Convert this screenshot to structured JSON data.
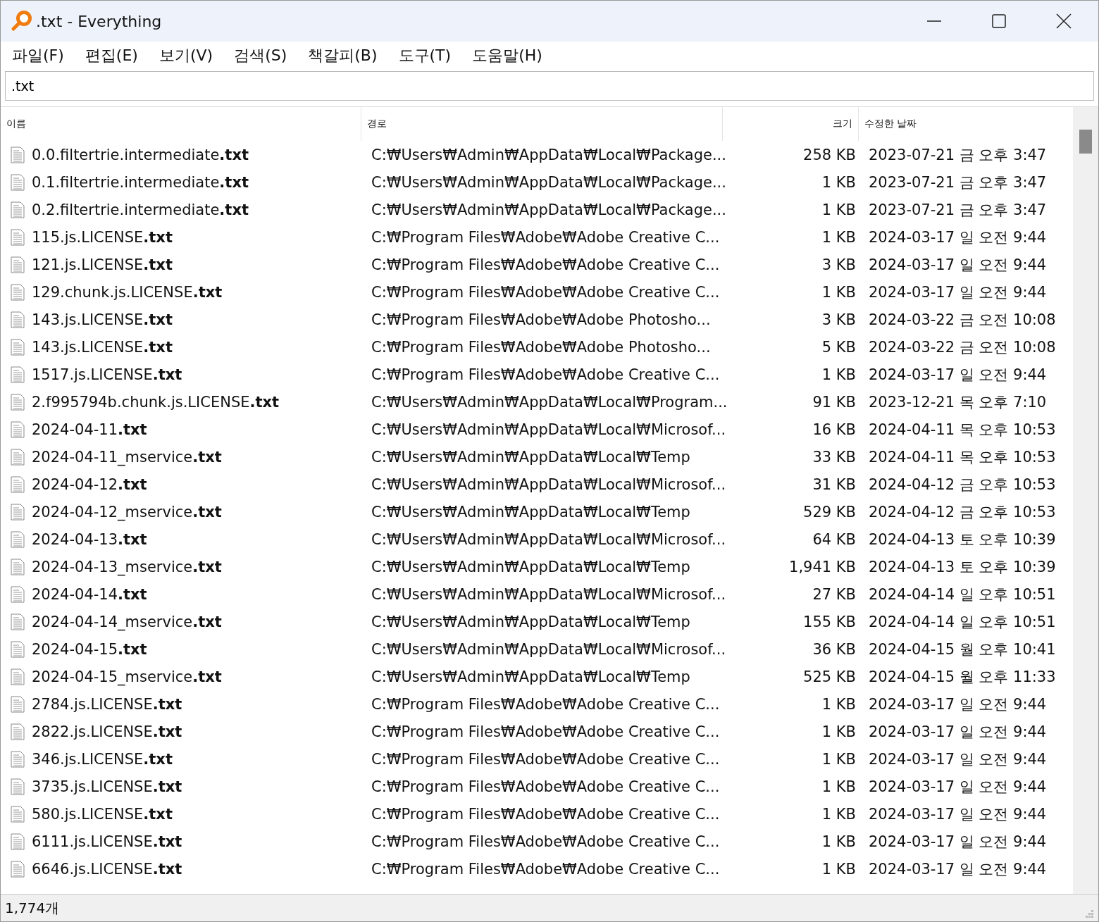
{
  "window": {
    "title": ".txt - Everything"
  },
  "menu": [
    "파일(F)",
    "편집(E)",
    "보기(V)",
    "검색(S)",
    "책갈피(B)",
    "도구(T)",
    "도움말(H)"
  ],
  "search": {
    "value": ".txt"
  },
  "table": {
    "columns": [
      "이름",
      "경로",
      "크기",
      "수정한 날짜"
    ],
    "rows": [
      {
        "name": "0.0.filtertrie.intermediate**.txt**",
        "path": "C:₩Users₩Admin₩AppData₩Local₩Package...",
        "size": "258 KB",
        "date": "2023-07-21 금 오후 3:47"
      },
      {
        "name": "0.1.filtertrie.intermediate**.txt**",
        "path": "C:₩Users₩Admin₩AppData₩Local₩Package...",
        "size": "1 KB",
        "date": "2023-07-21 금 오후 3:47"
      },
      {
        "name": "0.2.filtertrie.intermediate**.txt**",
        "path": "C:₩Users₩Admin₩AppData₩Local₩Package...",
        "size": "1 KB",
        "date": "2023-07-21 금 오후 3:47"
      },
      {
        "name": "115.js.LICENSE**.txt**",
        "path": "C:₩Program Files₩Adobe₩Adobe Creative C...",
        "size": "1 KB",
        "date": "2024-03-17 일 오전 9:44"
      },
      {
        "name": "121.js.LICENSE**.txt**",
        "path": "C:₩Program Files₩Adobe₩Adobe Creative C...",
        "size": "3 KB",
        "date": "2024-03-17 일 오전 9:44"
      },
      {
        "name": "129.chunk.js.LICENSE**.txt**",
        "path": "C:₩Program Files₩Adobe₩Adobe Creative C...",
        "size": "1 KB",
        "date": "2024-03-17 일 오전 9:44"
      },
      {
        "name": "143.js.LICENSE**.txt**",
        "path": "C:₩Program Files₩Adobe₩Adobe Photosho...",
        "size": "3 KB",
        "date": "2024-03-22 금 오전 10:08"
      },
      {
        "name": "143.js.LICENSE**.txt**",
        "path": "C:₩Program Files₩Adobe₩Adobe Photosho...",
        "size": "5 KB",
        "date": "2024-03-22 금 오전 10:08"
      },
      {
        "name": "1517.js.LICENSE**.txt**",
        "path": "C:₩Program Files₩Adobe₩Adobe Creative C...",
        "size": "1 KB",
        "date": "2024-03-17 일 오전 9:44"
      },
      {
        "name": "2.f995794b.chunk.js.LICENSE**.txt**",
        "path": "C:₩Users₩Admin₩AppData₩Local₩Program...",
        "size": "91 KB",
        "date": "2023-12-21 목 오후 7:10"
      },
      {
        "name": "2024-04-11**.txt**",
        "path": "C:₩Users₩Admin₩AppData₩Local₩Microsof...",
        "size": "16 KB",
        "date": "2024-04-11 목 오후 10:53"
      },
      {
        "name": "2024-04-11_mservice**.txt**",
        "path": "C:₩Users₩Admin₩AppData₩Local₩Temp",
        "size": "33 KB",
        "date": "2024-04-11 목 오후 10:53"
      },
      {
        "name": "2024-04-12**.txt**",
        "path": "C:₩Users₩Admin₩AppData₩Local₩Microsof...",
        "size": "31 KB",
        "date": "2024-04-12 금 오후 10:53"
      },
      {
        "name": "2024-04-12_mservice**.txt**",
        "path": "C:₩Users₩Admin₩AppData₩Local₩Temp",
        "size": "529 KB",
        "date": "2024-04-12 금 오후 10:53"
      },
      {
        "name": "2024-04-13**.txt**",
        "path": "C:₩Users₩Admin₩AppData₩Local₩Microsof...",
        "size": "64 KB",
        "date": "2024-04-13 토 오후 10:39"
      },
      {
        "name": "2024-04-13_mservice**.txt**",
        "path": "C:₩Users₩Admin₩AppData₩Local₩Temp",
        "size": "1,941 KB",
        "date": "2024-04-13 토 오후 10:39"
      },
      {
        "name": "2024-04-14**.txt**",
        "path": "C:₩Users₩Admin₩AppData₩Local₩Microsof...",
        "size": "27 KB",
        "date": "2024-04-14 일 오후 10:51"
      },
      {
        "name": "2024-04-14_mservice**.txt**",
        "path": "C:₩Users₩Admin₩AppData₩Local₩Temp",
        "size": "155 KB",
        "date": "2024-04-14 일 오후 10:51"
      },
      {
        "name": "2024-04-15**.txt**",
        "path": "C:₩Users₩Admin₩AppData₩Local₩Microsof...",
        "size": "36 KB",
        "date": "2024-04-15 월 오후 10:41"
      },
      {
        "name": "2024-04-15_mservice**.txt**",
        "path": "C:₩Users₩Admin₩AppData₩Local₩Temp",
        "size": "525 KB",
        "date": "2024-04-15 월 오후 11:33"
      },
      {
        "name": "2784.js.LICENSE**.txt**",
        "path": "C:₩Program Files₩Adobe₩Adobe Creative C...",
        "size": "1 KB",
        "date": "2024-03-17 일 오전 9:44"
      },
      {
        "name": "2822.js.LICENSE**.txt**",
        "path": "C:₩Program Files₩Adobe₩Adobe Creative C...",
        "size": "1 KB",
        "date": "2024-03-17 일 오전 9:44"
      },
      {
        "name": "346.js.LICENSE**.txt**",
        "path": "C:₩Program Files₩Adobe₩Adobe Creative C...",
        "size": "1 KB",
        "date": "2024-03-17 일 오전 9:44"
      },
      {
        "name": "3735.js.LICENSE**.txt**",
        "path": "C:₩Program Files₩Adobe₩Adobe Creative C...",
        "size": "1 KB",
        "date": "2024-03-17 일 오전 9:44"
      },
      {
        "name": "580.js.LICENSE**.txt**",
        "path": "C:₩Program Files₩Adobe₩Adobe Creative C...",
        "size": "1 KB",
        "date": "2024-03-17 일 오전 9:44"
      },
      {
        "name": "6111.js.LICENSE**.txt**",
        "path": "C:₩Program Files₩Adobe₩Adobe Creative C...",
        "size": "1 KB",
        "date": "2024-03-17 일 오전 9:44"
      },
      {
        "name": "6646.js.LICENSE**.txt**",
        "path": "C:₩Program Files₩Adobe₩Adobe Creative C...",
        "size": "1 KB",
        "date": "2024-03-17 일 오전 9:44"
      }
    ]
  },
  "status_bar": {
    "count": "1,774개"
  }
}
